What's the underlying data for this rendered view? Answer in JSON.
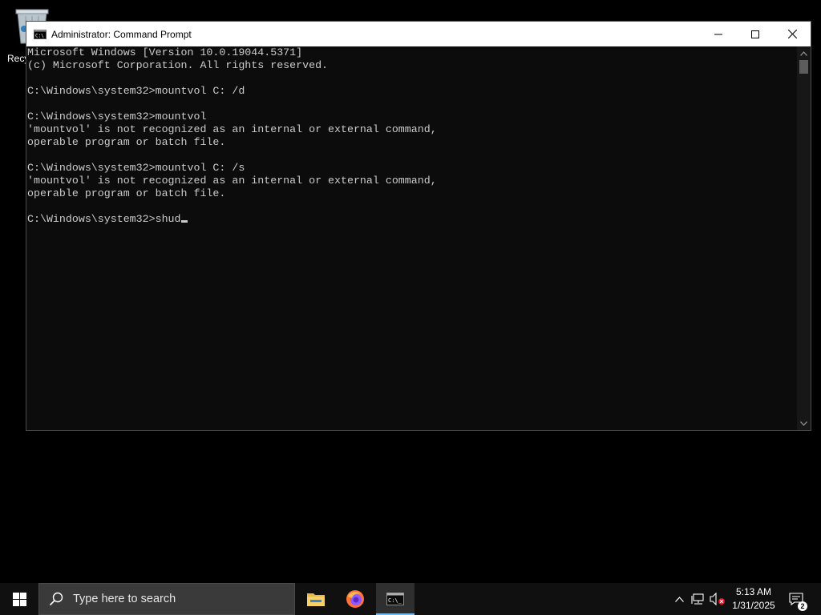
{
  "desktop": {
    "recycle_bin_label": "Recy"
  },
  "window": {
    "title": "Administrator: Command Prompt",
    "icon": "cmd-icon",
    "controls": [
      "minimize-icon",
      "maximize-icon",
      "close-icon"
    ]
  },
  "console": {
    "lines": [
      "Microsoft Windows [Version 10.0.19044.5371]",
      "(c) Microsoft Corporation. All rights reserved.",
      "",
      "C:\\Windows\\system32>mountvol C: /d",
      "",
      "C:\\Windows\\system32>mountvol",
      "'mountvol' is not recognized as an internal or external command,",
      "operable program or batch file.",
      "",
      "C:\\Windows\\system32>mountvol C: /s",
      "'mountvol' is not recognized as an internal or external command,",
      "operable program or batch file.",
      ""
    ],
    "prompt": "C:\\Windows\\system32>",
    "current_input": "shud"
  },
  "taskbar": {
    "search_placeholder": "Type here to search",
    "apps": [
      "file-explorer-icon",
      "firefox-icon",
      "command-prompt-icon"
    ],
    "clock_time": "5:13 AM",
    "clock_date": "1/31/2025",
    "notification_count": "2",
    "colors": {
      "taskbar_bg": "#101010",
      "active_indicator": "#76b9ed",
      "console_bg": "#0c0c0c",
      "console_text": "#cccccc"
    }
  }
}
